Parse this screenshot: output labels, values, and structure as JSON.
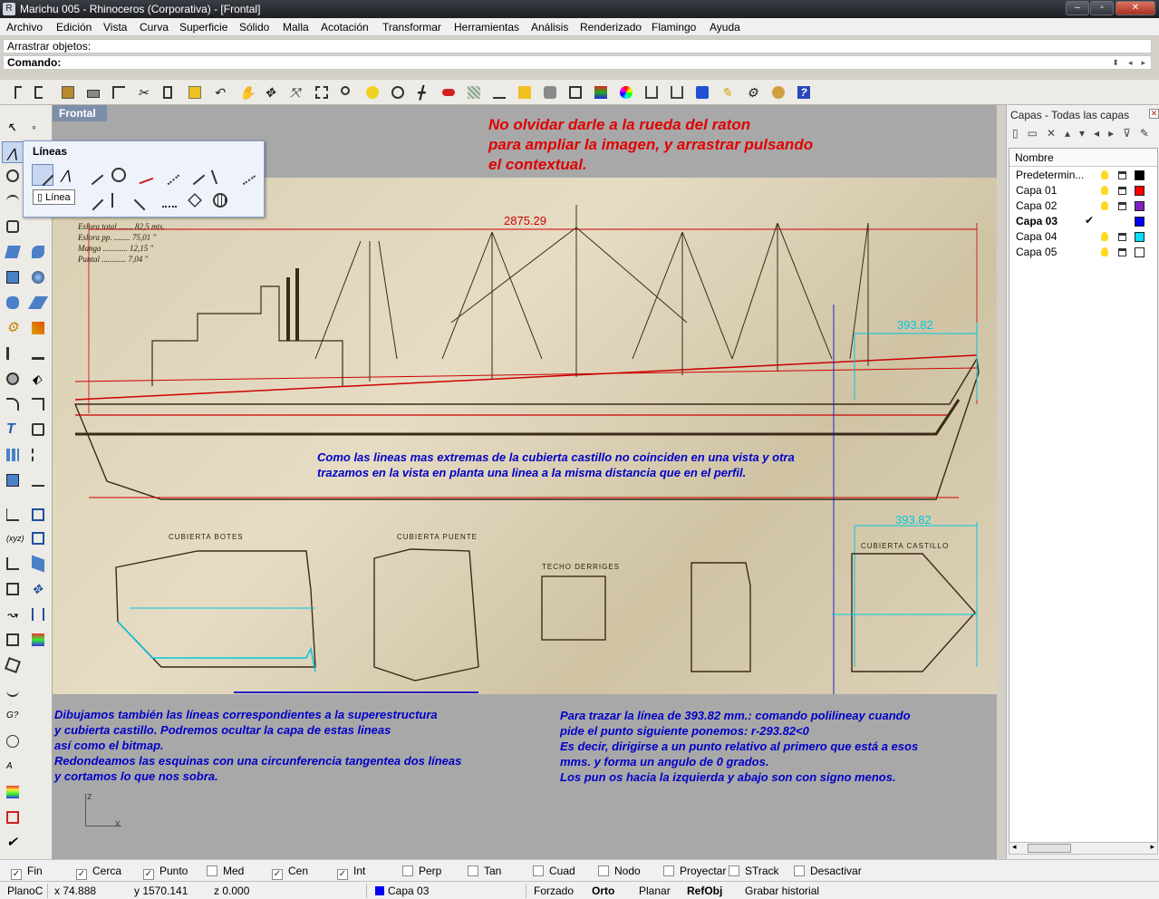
{
  "window": {
    "title": "Marichu 005 - Rhinoceros (Corporativa) - [Frontal]"
  },
  "menu": [
    "Archivo",
    "Edición",
    "Vista",
    "Curva",
    "Superficie",
    "Sólido",
    "Malla",
    "Acotación",
    "Transformar",
    "Herramientas",
    "Análisis",
    "Renderizado",
    "Flamingo",
    "Ayuda"
  ],
  "command": {
    "history_line": "Arrastrar objetos:",
    "prompt_label": "Comando:"
  },
  "viewport": {
    "tab": "Frontal",
    "note_top": [
      "No olvidar darle a la rueda del raton",
      "para ampliar la imagen, y arrastrar pulsando",
      "el contextual."
    ],
    "note_middle": [
      "Como las lineas mas extremas de la cubierta castillo no coinciden en una vista y otra",
      "trazamos en la vista en planta una linea a la misma distancia que en el perfil."
    ],
    "note_left": [
      "Dibujamos también las líneas correspondientes a la  superestructura",
      "y cubierta castillo. Podremos ocultar la capa de estas lineas",
      "así como el bitmap.",
      "Redondeamos las esquinas con una circunferencia tangentea dos líneas",
      "y cortamos lo que nos sobra."
    ],
    "note_right": [
      "Para trazar la línea de 393.82 mm.: comando polilineay cuando",
      "pide el punto siguiente ponemos: r-293.82<0",
      "Es decir, dirigirse a un punto relativo al primero que está a esos",
      "mms. y forma un angulo de 0 grados.",
      "Los pun os hacia la izquierda y abajo son con signo menos."
    ],
    "dim_length": "2875.29",
    "dim_castillo_profile": "393.82",
    "dim_castillo_plan": "393.82",
    "specs": [
      "Eslora total ....... 82,5 mts.",
      "Eslora pp. ........ 75,01 \"",
      "Manga ............ 12,15 \"",
      "Puntal ............ 7,04 \""
    ],
    "plan_labels": [
      "CUBIERTA BOTES",
      "CUBIERTA PUENTE",
      "TECHO DERRIGES",
      "CUBIERTA CASTILLO"
    ],
    "axis_z": "z",
    "axis_x": "x"
  },
  "lineas_panel": {
    "title": "Líneas",
    "tooltip": "Línea"
  },
  "layers": {
    "header": "Capas - Todas las capas",
    "column": "Nombre",
    "rows": [
      {
        "name": "Predetermin...",
        "color": "#000000",
        "current": false
      },
      {
        "name": "Capa 01",
        "color": "#ff0000",
        "current": false
      },
      {
        "name": "Capa 02",
        "color": "#8020c0",
        "current": false
      },
      {
        "name": "Capa 03",
        "color": "#0000ff",
        "current": true,
        "check": "✔"
      },
      {
        "name": "Capa 04",
        "color": "#00e0ff",
        "current": false
      },
      {
        "name": "Capa 05",
        "color": "#ffffff",
        "current": false
      }
    ]
  },
  "osnaps": [
    {
      "label": "Fin",
      "checked": true
    },
    {
      "label": "Cerca",
      "checked": true
    },
    {
      "label": "Punto",
      "checked": true
    },
    {
      "label": "Med",
      "checked": false
    },
    {
      "label": "Cen",
      "checked": true
    },
    {
      "label": "Int",
      "checked": true
    },
    {
      "label": "Perp",
      "checked": false
    },
    {
      "label": "Tan",
      "checked": false
    },
    {
      "label": "Cuad",
      "checked": false
    },
    {
      "label": "Nodo",
      "checked": false
    },
    {
      "label": "Proyectar",
      "checked": false
    },
    {
      "label": "STrack",
      "checked": false
    },
    {
      "label": "Desactivar",
      "checked": false
    }
  ],
  "status": {
    "plane": "PlanoC",
    "x": "x 74.888",
    "y": "y 1570.141",
    "z": "z 0.000",
    "layer": "Capa 03",
    "layer_color": "#0000ff",
    "buttons": [
      "Forzado",
      "Orto",
      "Planar",
      "RefObj",
      "Grabar historial"
    ]
  },
  "colors": {
    "note_red": "#e00000",
    "note_blue": "#0000c8",
    "dim_red": "#cc0000",
    "dim_cyan": "#00c8e0"
  }
}
